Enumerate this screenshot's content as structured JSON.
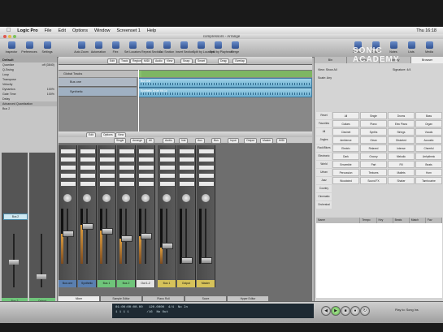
{
  "menubar": {
    "app": "Logic Pro",
    "items": [
      "File",
      "Edit",
      "Options",
      "Window",
      "Screenset 1",
      "Help"
    ],
    "clock": "Thu 16:18"
  },
  "window": {
    "title": "compressors - Arrange"
  },
  "toolbar": {
    "left": [
      "Inspector",
      "Preferences",
      "Settings"
    ],
    "center": [
      "Auto Zoom",
      "Automation",
      "Flex",
      "Set Locators",
      "Repeat Section",
      "Cut Section",
      "Insert Section",
      "Split by Locators",
      "Split by Playhead",
      "Merge"
    ],
    "right": [
      "Bounce",
      "Colors",
      "Notes",
      "Lists",
      "Media"
    ]
  },
  "inspector": {
    "title": "Default",
    "params": [
      {
        "k": "Quantize",
        "v": "off (3840)"
      },
      {
        "k": "Q-Swing",
        "v": ""
      },
      {
        "k": "Loop",
        "v": ""
      },
      {
        "k": "Transpose",
        "v": ""
      },
      {
        "k": "Velocity",
        "v": ""
      },
      {
        "k": "Dynamics",
        "v": "100%"
      },
      {
        "k": "Gate Time",
        "v": "100%"
      },
      {
        "k": "Delay",
        "v": ""
      }
    ],
    "section": "Advanced Quantization",
    "sub": "Bus 2"
  },
  "arrange": {
    "edit_menus": [
      "Edit",
      "Track",
      "Region",
      "MIDI",
      "Audio",
      "View"
    ],
    "snap": "Smart",
    "drag": "Overlap",
    "global_tracks": "Global Tracks",
    "tracks": [
      {
        "name": "Bus one",
        "region": "Bus one"
      },
      {
        "name": "Synthetic",
        "region": "Synthetic Drum Kit.1c"
      }
    ]
  },
  "mixer": {
    "menus": [
      "Edit",
      "Options",
      "View"
    ],
    "filters": [
      "Single",
      "Arrange",
      "All",
      "Audio",
      "Inst",
      "Aux",
      "Bus",
      "Input",
      "Output",
      "Master",
      "MIDI"
    ],
    "channels": [
      {
        "name": "Bus one",
        "color": "#5a7fb0",
        "level": 0.55
      },
      {
        "name": "Synthetic",
        "color": "#5a7fb0",
        "level": 0.7
      },
      {
        "name": "Bus 1",
        "color": "#6fc47a",
        "level": 0.6
      },
      {
        "name": "Bus 2",
        "color": "#6fc47a",
        "level": 0.45
      },
      {
        "name": "Out 1-2",
        "color": "#e4e4e4",
        "level": 0.5
      },
      {
        "name": "Bus 1",
        "color": "#d6c25a",
        "level": 0.3
      },
      {
        "name": "Output",
        "color": "#d6c25a",
        "level": 0.0
      },
      {
        "name": "Master",
        "color": "#d6c25a",
        "level": 0.0
      }
    ],
    "inspector_channels": [
      "Bus 2",
      "Output"
    ]
  },
  "bottom_tabs": [
    "Mixer",
    "Sample Editor",
    "Piano Roll",
    "Score",
    "Hyper Editor"
  ],
  "browser": {
    "tabs": [
      "Bin",
      "Loops",
      "Library",
      "Browser"
    ],
    "view": "Show All",
    "signature": "4/4",
    "scale": "Any",
    "left_col": [
      "Reset",
      "Favorites",
      "All",
      "Jingles",
      "Rock/Blues",
      "Electronic",
      "World",
      "Urban",
      "Jazz",
      "Country",
      "Cinematic",
      "Orchestral"
    ],
    "keywords": [
      "All",
      "Single",
      "Drums",
      "Bass",
      "Guitars",
      "Piano",
      "Elec Piano",
      "Organ",
      "Clavinet",
      "Synths",
      "Strings",
      "Vocals",
      "Ambience",
      "Clean",
      "Distorted",
      "Acoustic",
      "Electric",
      "Relaxed",
      "Intense",
      "Cheerful",
      "Dark",
      "Groovy",
      "Melodic",
      "Arrhythmic",
      "Ensemble",
      "Part",
      "Fill",
      "Beats",
      "Percussion",
      "Textures",
      "Mallets",
      "Horn",
      "Woodwind",
      "Sound FX",
      "Shaker",
      "Tambourine"
    ],
    "columns": [
      "Name",
      "Tempo",
      "Key",
      "Beats",
      "Match",
      "Fav"
    ]
  },
  "transport": {
    "position": "1 1 1 1",
    "smpte": "01:00:00:00.00",
    "tempo": "120.0000",
    "division": "/16",
    "in": "No In",
    "out": "No Out",
    "signature": "4/4",
    "play_to": "Play to: Song Ins"
  },
  "watermark": {
    "line1": "SONIC",
    "line2": "ACADEMY"
  }
}
